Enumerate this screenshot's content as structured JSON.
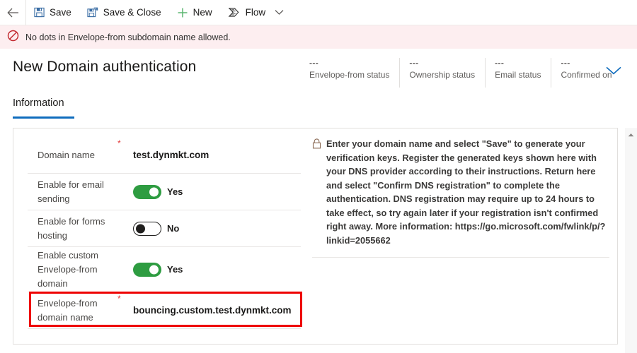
{
  "commandbar": {
    "back_label": "Back",
    "items": [
      {
        "label": "Save",
        "icon": "save-icon"
      },
      {
        "label": "Save & Close",
        "icon": "save-and-close-icon"
      },
      {
        "label": "New",
        "icon": "plus-icon"
      },
      {
        "label": "Flow",
        "icon": "flow-icon"
      }
    ],
    "overflow_icon": "chevron-down-icon"
  },
  "error_banner": {
    "icon": "blocked-icon",
    "message": "No dots in Envelope-from subdomain name allowed."
  },
  "header": {
    "title": "New Domain authentication",
    "expand_icon": "chevron-down-icon",
    "statuses": [
      {
        "value": "---",
        "label": "Envelope-from status"
      },
      {
        "value": "---",
        "label": "Ownership status"
      },
      {
        "value": "---",
        "label": "Email status"
      },
      {
        "value": "---",
        "label": "Confirmed on"
      }
    ]
  },
  "tabs": [
    {
      "label": "Information",
      "selected": true
    }
  ],
  "form": {
    "fields": [
      {
        "label": "Domain name",
        "required": "*",
        "type": "text",
        "value": "test.dynmkt.com"
      },
      {
        "label": "Enable for email sending",
        "required": "",
        "type": "toggle",
        "state": "on",
        "value": "Yes"
      },
      {
        "label": "Enable for forms hosting",
        "required": "",
        "type": "toggle",
        "state": "off",
        "value": "No"
      },
      {
        "label": "Enable custom Envelope-from domain",
        "required": "",
        "type": "toggle",
        "state": "on",
        "value": "Yes"
      },
      {
        "label": "Envelope-from domain name",
        "required": "*",
        "type": "text",
        "value": "bouncing.custom.test.dynmkt.com"
      }
    ]
  },
  "help": {
    "icon": "lock-icon",
    "text": "Enter your domain name and select \"Save\" to generate your verification keys. Register the generated keys shown here with your DNS provider according to their instructions. Return here and select \"Confirm DNS registration\" to complete the authentication. DNS registration may require up to 24 hours to take effect, so try again later if your registration isn't confirmed right away. More information: https://go.microsoft.com/fwlink/p/?linkid=2055662"
  },
  "scrollbar": {
    "up_icon": "caret-up-icon"
  },
  "colors": {
    "accent": "#0f6cbd",
    "toggle_on": "#2e9c41",
    "error_banner_bg": "#fdeef0",
    "error_icon": "#c2272d",
    "highlight": "#ee0000",
    "required_star": "#e23b3b"
  }
}
